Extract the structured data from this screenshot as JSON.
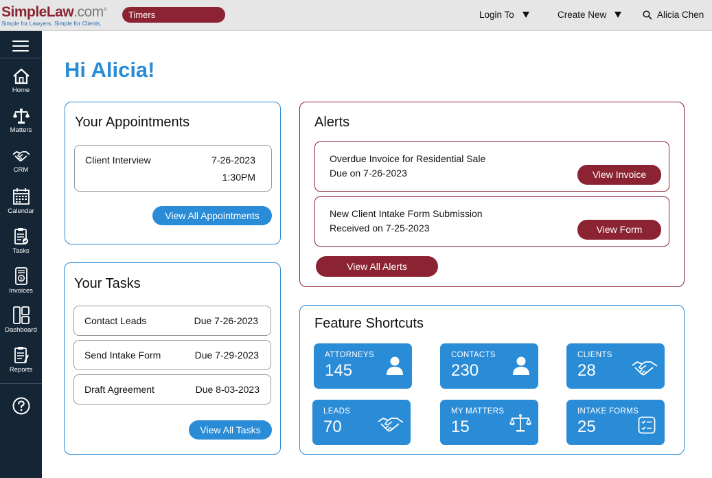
{
  "logo": {
    "simple": "Simple",
    "law": "Law",
    "com": ".com",
    "reg": "®",
    "tagline": "Simple for Lawyers. Simple for Clients."
  },
  "timers_label": "Timers",
  "topnav": {
    "login_to": "Login To",
    "create_new": "Create New",
    "user_name": "Alicia Chen"
  },
  "sidebar": {
    "items": [
      {
        "label": "Home",
        "icon": "home-icon"
      },
      {
        "label": "Matters",
        "icon": "scales-icon"
      },
      {
        "label": "CRM",
        "icon": "handshake-icon"
      },
      {
        "label": "Calendar",
        "icon": "calendar-icon"
      },
      {
        "label": "Tasks",
        "icon": "clipboard-check-icon"
      },
      {
        "label": "Invoices",
        "icon": "invoice-icon"
      },
      {
        "label": "Dashboard",
        "icon": "dashboard-icon"
      },
      {
        "label": "Reports",
        "icon": "report-icon"
      }
    ],
    "help_icon": "help-icon"
  },
  "greeting": "Hi Alicia!",
  "appointments": {
    "title": "Your Appointments",
    "items": [
      {
        "name": "Client Interview",
        "date": "7-26-2023",
        "time": "1:30PM"
      }
    ],
    "view_all": "View All Appointments"
  },
  "tasks": {
    "title": "Your Tasks",
    "items": [
      {
        "name": "Contact Leads",
        "due": "Due 7-26-2023"
      },
      {
        "name": "Send Intake Form",
        "due": "Due 7-29-2023"
      },
      {
        "name": "Draft Agreement",
        "due": "Due 8-03-2023"
      }
    ],
    "view_all": "View All Tasks"
  },
  "alerts": {
    "title": "Alerts",
    "items": [
      {
        "line1": "Overdue Invoice for Residential Sale",
        "line2": "Due on 7-26-2023",
        "action": "View Invoice"
      },
      {
        "line1": "New Client Intake Form Submission",
        "line2": "Received on 7-25-2023",
        "action": "View Form"
      }
    ],
    "view_all": "View All Alerts"
  },
  "shortcuts": {
    "title": "Feature Shortcuts",
    "tiles": [
      {
        "label": "ATTORNEYS",
        "value": "145",
        "icon": "person-icon"
      },
      {
        "label": "CONTACTS",
        "value": "230",
        "icon": "person-icon"
      },
      {
        "label": "CLIENTS",
        "value": "28",
        "icon": "handshake-icon"
      },
      {
        "label": "LEADS",
        "value": "70",
        "icon": "handshake-icon"
      },
      {
        "label": "MY MATTERS",
        "value": "15",
        "icon": "scales-icon"
      },
      {
        "label": "INTAKE FORMS",
        "value": "25",
        "icon": "form-checklist-icon"
      }
    ]
  },
  "colors": {
    "brand_red": "#8b2332",
    "accent_blue": "#2a8bd6",
    "sidebar_bg": "#142535"
  }
}
